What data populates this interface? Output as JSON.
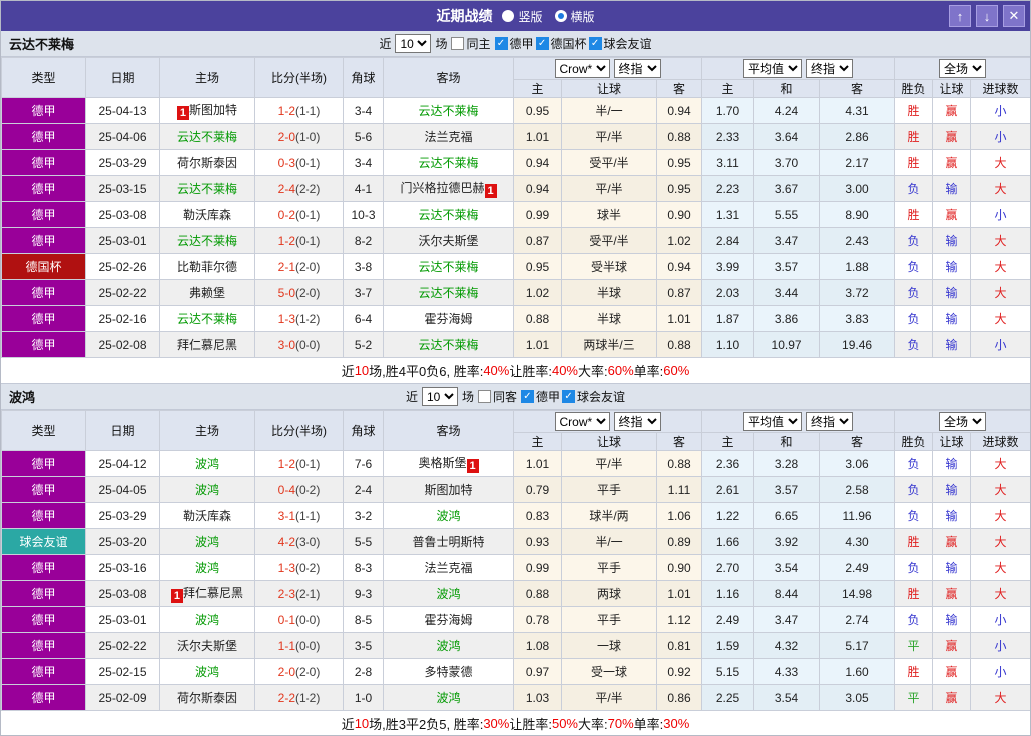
{
  "title_bar": {
    "title": "近期战绩",
    "radios": [
      {
        "label": "竖版",
        "selected": false
      },
      {
        "label": "横版",
        "selected": true
      }
    ],
    "buttons": {
      "up": "↑",
      "down": "↓",
      "close": "✕"
    }
  },
  "icons": {
    "check": "✓",
    "up-arrow": "↑",
    "down-arrow": "↓",
    "close": "✕"
  },
  "table_header": {
    "main": [
      "类型",
      "日期",
      "主场",
      "比分(半场)",
      "角球",
      "客场"
    ],
    "sub": [
      "主",
      "让球",
      "客",
      "主",
      "和",
      "客",
      "胜负",
      "让球",
      "进球数"
    ],
    "selects": {
      "crow": "Crow*",
      "final1": "终指",
      "avg": "平均值",
      "final2": "终指",
      "full": "全场"
    }
  },
  "league_colors": {
    "德甲": "#990099",
    "德国杯": "#b01111",
    "球会友谊": "#2ba8a4"
  },
  "status_colors": {
    "win": "#e02020",
    "lose": "#3535cf",
    "draw": "#2ba32b",
    "big": "#e02020",
    "small": "#3535cf"
  },
  "sections": [
    {
      "team": "云达不莱梅",
      "filter": {
        "prefix": "近",
        "count": "10",
        "suffix": "场",
        "same": {
          "label": "同主",
          "checked": false
        },
        "leagues": [
          {
            "label": "德甲",
            "checked": true
          },
          {
            "label": "德国杯",
            "checked": true
          },
          {
            "label": "球会友谊",
            "checked": true
          }
        ]
      },
      "rows": [
        {
          "league": "德甲",
          "date": "25-04-13",
          "home": {
            "name": "斯图加特",
            "self": false,
            "card": "before"
          },
          "score": {
            "ft": "1-2",
            "ht": "(1-1)"
          },
          "corner": "3-4",
          "away": {
            "name": "云达不莱梅",
            "self": true,
            "card": null
          },
          "odds": [
            "0.95",
            "半/一",
            "0.94"
          ],
          "avg": [
            "1.70",
            "4.24",
            "4.31"
          ],
          "results": [
            [
              "胜",
              "win"
            ],
            [
              "赢",
              "win"
            ],
            [
              "小",
              "small"
            ]
          ]
        },
        {
          "league": "德甲",
          "date": "25-04-06",
          "home": {
            "name": "云达不莱梅",
            "self": true,
            "card": null
          },
          "score": {
            "ft": "2-0",
            "ht": "(1-0)"
          },
          "corner": "5-6",
          "away": {
            "name": "法兰克福",
            "self": false,
            "card": null
          },
          "odds": [
            "1.01",
            "平/半",
            "0.88"
          ],
          "avg": [
            "2.33",
            "3.64",
            "2.86"
          ],
          "results": [
            [
              "胜",
              "win"
            ],
            [
              "赢",
              "win"
            ],
            [
              "小",
              "small"
            ]
          ]
        },
        {
          "league": "德甲",
          "date": "25-03-29",
          "home": {
            "name": "荷尔斯泰因",
            "self": false,
            "card": null
          },
          "score": {
            "ft": "0-3",
            "ht": "(0-1)"
          },
          "corner": "3-4",
          "away": {
            "name": "云达不莱梅",
            "self": true,
            "card": null
          },
          "odds": [
            "0.94",
            "受平/半",
            "0.95"
          ],
          "avg": [
            "3.11",
            "3.70",
            "2.17"
          ],
          "results": [
            [
              "胜",
              "win"
            ],
            [
              "赢",
              "win"
            ],
            [
              "大",
              "big"
            ]
          ]
        },
        {
          "league": "德甲",
          "date": "25-03-15",
          "home": {
            "name": "云达不莱梅",
            "self": true,
            "card": null
          },
          "score": {
            "ft": "2-4",
            "ht": "(2-2)"
          },
          "corner": "4-1",
          "away": {
            "name": "门兴格拉德巴赫",
            "self": false,
            "card": "after"
          },
          "odds": [
            "0.94",
            "平/半",
            "0.95"
          ],
          "avg": [
            "2.23",
            "3.67",
            "3.00"
          ],
          "results": [
            [
              "负",
              "lose"
            ],
            [
              "输",
              "lose"
            ],
            [
              "大",
              "big"
            ]
          ]
        },
        {
          "league": "德甲",
          "date": "25-03-08",
          "home": {
            "name": "勒沃库森",
            "self": false,
            "card": null
          },
          "score": {
            "ft": "0-2",
            "ht": "(0-1)"
          },
          "corner": "10-3",
          "away": {
            "name": "云达不莱梅",
            "self": true,
            "card": null
          },
          "odds": [
            "0.99",
            "球半",
            "0.90"
          ],
          "avg": [
            "1.31",
            "5.55",
            "8.90"
          ],
          "results": [
            [
              "胜",
              "win"
            ],
            [
              "赢",
              "win"
            ],
            [
              "小",
              "small"
            ]
          ]
        },
        {
          "league": "德甲",
          "date": "25-03-01",
          "home": {
            "name": "云达不莱梅",
            "self": true,
            "card": null
          },
          "score": {
            "ft": "1-2",
            "ht": "(0-1)"
          },
          "corner": "8-2",
          "away": {
            "name": "沃尔夫斯堡",
            "self": false,
            "card": null
          },
          "odds": [
            "0.87",
            "受平/半",
            "1.02"
          ],
          "avg": [
            "2.84",
            "3.47",
            "2.43"
          ],
          "results": [
            [
              "负",
              "lose"
            ],
            [
              "输",
              "lose"
            ],
            [
              "大",
              "big"
            ]
          ]
        },
        {
          "league": "德国杯",
          "date": "25-02-26",
          "home": {
            "name": "比勒菲尔德",
            "self": false,
            "card": null
          },
          "score": {
            "ft": "2-1",
            "ht": "(2-0)"
          },
          "corner": "3-8",
          "away": {
            "name": "云达不莱梅",
            "self": true,
            "card": null
          },
          "odds": [
            "0.95",
            "受半球",
            "0.94"
          ],
          "avg": [
            "3.99",
            "3.57",
            "1.88"
          ],
          "results": [
            [
              "负",
              "lose"
            ],
            [
              "输",
              "lose"
            ],
            [
              "大",
              "big"
            ]
          ]
        },
        {
          "league": "德甲",
          "date": "25-02-22",
          "home": {
            "name": "弗赖堡",
            "self": false,
            "card": null
          },
          "score": {
            "ft": "5-0",
            "ht": "(2-0)"
          },
          "corner": "3-7",
          "away": {
            "name": "云达不莱梅",
            "self": true,
            "card": null
          },
          "odds": [
            "1.02",
            "半球",
            "0.87"
          ],
          "avg": [
            "2.03",
            "3.44",
            "3.72"
          ],
          "results": [
            [
              "负",
              "lose"
            ],
            [
              "输",
              "lose"
            ],
            [
              "大",
              "big"
            ]
          ]
        },
        {
          "league": "德甲",
          "date": "25-02-16",
          "home": {
            "name": "云达不莱梅",
            "self": true,
            "card": null
          },
          "score": {
            "ft": "1-3",
            "ht": "(1-2)"
          },
          "corner": "6-4",
          "away": {
            "name": "霍芬海姆",
            "self": false,
            "card": null
          },
          "odds": [
            "0.88",
            "半球",
            "1.01"
          ],
          "avg": [
            "1.87",
            "3.86",
            "3.83"
          ],
          "results": [
            [
              "负",
              "lose"
            ],
            [
              "输",
              "lose"
            ],
            [
              "大",
              "big"
            ]
          ]
        },
        {
          "league": "德甲",
          "date": "25-02-08",
          "home": {
            "name": "拜仁慕尼黑",
            "self": false,
            "card": null
          },
          "score": {
            "ft": "3-0",
            "ht": "(0-0)"
          },
          "corner": "5-2",
          "away": {
            "name": "云达不莱梅",
            "self": true,
            "card": null
          },
          "odds": [
            "1.01",
            "两球半/三",
            "0.88"
          ],
          "avg": [
            "1.10",
            "10.97",
            "19.46"
          ],
          "results": [
            [
              "负",
              "lose"
            ],
            [
              "输",
              "lose"
            ],
            [
              "小",
              "small"
            ]
          ]
        }
      ],
      "summary": [
        [
          "近",
          "b"
        ],
        [
          "10",
          "r"
        ],
        [
          "场,胜4平0负6, 胜率:",
          "b"
        ],
        [
          "40%",
          "r"
        ],
        [
          " 让胜率:",
          "b"
        ],
        [
          "40%",
          "r"
        ],
        [
          " 大率:",
          "b"
        ],
        [
          "60%",
          "r"
        ],
        [
          " 单率:",
          "b"
        ],
        [
          "60%",
          "r"
        ]
      ]
    },
    {
      "team": "波鸿",
      "filter": {
        "prefix": "近",
        "count": "10",
        "suffix": "场",
        "same": {
          "label": "同客",
          "checked": false
        },
        "leagues": [
          {
            "label": "德甲",
            "checked": true
          },
          {
            "label": "球会友谊",
            "checked": true
          }
        ]
      },
      "rows": [
        {
          "league": "德甲",
          "date": "25-04-12",
          "home": {
            "name": "波鸿",
            "self": true,
            "card": null
          },
          "score": {
            "ft": "1-2",
            "ht": "(0-1)"
          },
          "corner": "7-6",
          "away": {
            "name": "奥格斯堡",
            "self": false,
            "card": "after"
          },
          "odds": [
            "1.01",
            "平/半",
            "0.88"
          ],
          "avg": [
            "2.36",
            "3.28",
            "3.06"
          ],
          "results": [
            [
              "负",
              "lose"
            ],
            [
              "输",
              "lose"
            ],
            [
              "大",
              "big"
            ]
          ]
        },
        {
          "league": "德甲",
          "date": "25-04-05",
          "home": {
            "name": "波鸿",
            "self": true,
            "card": null
          },
          "score": {
            "ft": "0-4",
            "ht": "(0-2)"
          },
          "corner": "2-4",
          "away": {
            "name": "斯图加特",
            "self": false,
            "card": null
          },
          "odds": [
            "0.79",
            "平手",
            "1.11"
          ],
          "avg": [
            "2.61",
            "3.57",
            "2.58"
          ],
          "results": [
            [
              "负",
              "lose"
            ],
            [
              "输",
              "lose"
            ],
            [
              "大",
              "big"
            ]
          ]
        },
        {
          "league": "德甲",
          "date": "25-03-29",
          "home": {
            "name": "勒沃库森",
            "self": false,
            "card": null
          },
          "score": {
            "ft": "3-1",
            "ht": "(1-1)"
          },
          "corner": "3-2",
          "away": {
            "name": "波鸿",
            "self": true,
            "card": null
          },
          "odds": [
            "0.83",
            "球半/两",
            "1.06"
          ],
          "avg": [
            "1.22",
            "6.65",
            "11.96"
          ],
          "results": [
            [
              "负",
              "lose"
            ],
            [
              "输",
              "lose"
            ],
            [
              "大",
              "big"
            ]
          ]
        },
        {
          "league": "球会友谊",
          "date": "25-03-20",
          "home": {
            "name": "波鸿",
            "self": true,
            "card": null
          },
          "score": {
            "ft": "4-2",
            "ht": "(3-0)"
          },
          "corner": "5-5",
          "away": {
            "name": "普鲁士明斯特",
            "self": false,
            "card": null
          },
          "odds": [
            "0.93",
            "半/一",
            "0.89"
          ],
          "avg": [
            "1.66",
            "3.92",
            "4.30"
          ],
          "results": [
            [
              "胜",
              "win"
            ],
            [
              "赢",
              "win"
            ],
            [
              "大",
              "big"
            ]
          ]
        },
        {
          "league": "德甲",
          "date": "25-03-16",
          "home": {
            "name": "波鸿",
            "self": true,
            "card": null
          },
          "score": {
            "ft": "1-3",
            "ht": "(0-2)"
          },
          "corner": "8-3",
          "away": {
            "name": "法兰克福",
            "self": false,
            "card": null
          },
          "odds": [
            "0.99",
            "平手",
            "0.90"
          ],
          "avg": [
            "2.70",
            "3.54",
            "2.49"
          ],
          "results": [
            [
              "负",
              "lose"
            ],
            [
              "输",
              "lose"
            ],
            [
              "大",
              "big"
            ]
          ]
        },
        {
          "league": "德甲",
          "date": "25-03-08",
          "home": {
            "name": "拜仁慕尼黑",
            "self": false,
            "card": "before"
          },
          "score": {
            "ft": "2-3",
            "ht": "(2-1)"
          },
          "corner": "9-3",
          "away": {
            "name": "波鸿",
            "self": true,
            "card": null
          },
          "odds": [
            "0.88",
            "两球",
            "1.01"
          ],
          "avg": [
            "1.16",
            "8.44",
            "14.98"
          ],
          "results": [
            [
              "胜",
              "win"
            ],
            [
              "赢",
              "win"
            ],
            [
              "大",
              "big"
            ]
          ]
        },
        {
          "league": "德甲",
          "date": "25-03-01",
          "home": {
            "name": "波鸿",
            "self": true,
            "card": null
          },
          "score": {
            "ft": "0-1",
            "ht": "(0-0)"
          },
          "corner": "8-5",
          "away": {
            "name": "霍芬海姆",
            "self": false,
            "card": null
          },
          "odds": [
            "0.78",
            "平手",
            "1.12"
          ],
          "avg": [
            "2.49",
            "3.47",
            "2.74"
          ],
          "results": [
            [
              "负",
              "lose"
            ],
            [
              "输",
              "lose"
            ],
            [
              "小",
              "small"
            ]
          ]
        },
        {
          "league": "德甲",
          "date": "25-02-22",
          "home": {
            "name": "沃尔夫斯堡",
            "self": false,
            "card": null
          },
          "score": {
            "ft": "1-1",
            "ht": "(0-0)"
          },
          "corner": "3-5",
          "away": {
            "name": "波鸿",
            "self": true,
            "card": null
          },
          "odds": [
            "1.08",
            "一球",
            "0.81"
          ],
          "avg": [
            "1.59",
            "4.32",
            "5.17"
          ],
          "results": [
            [
              "平",
              "draw"
            ],
            [
              "赢",
              "win"
            ],
            [
              "小",
              "small"
            ]
          ]
        },
        {
          "league": "德甲",
          "date": "25-02-15",
          "home": {
            "name": "波鸿",
            "self": true,
            "card": null
          },
          "score": {
            "ft": "2-0",
            "ht": "(2-0)"
          },
          "corner": "2-8",
          "away": {
            "name": "多特蒙德",
            "self": false,
            "card": null
          },
          "odds": [
            "0.97",
            "受一球",
            "0.92"
          ],
          "avg": [
            "5.15",
            "4.33",
            "1.60"
          ],
          "results": [
            [
              "胜",
              "win"
            ],
            [
              "赢",
              "win"
            ],
            [
              "小",
              "small"
            ]
          ]
        },
        {
          "league": "德甲",
          "date": "25-02-09",
          "home": {
            "name": "荷尔斯泰因",
            "self": false,
            "card": null
          },
          "score": {
            "ft": "2-2",
            "ht": "(1-2)"
          },
          "corner": "1-0",
          "away": {
            "name": "波鸿",
            "self": true,
            "card": null
          },
          "odds": [
            "1.03",
            "平/半",
            "0.86"
          ],
          "avg": [
            "2.25",
            "3.54",
            "3.05"
          ],
          "results": [
            [
              "平",
              "draw"
            ],
            [
              "赢",
              "win"
            ],
            [
              "大",
              "big"
            ]
          ]
        }
      ],
      "summary": [
        [
          "近",
          "b"
        ],
        [
          "10",
          "r"
        ],
        [
          "场,胜3平2负5, 胜率:",
          "b"
        ],
        [
          "30%",
          "r"
        ],
        [
          " 让胜率:",
          "b"
        ],
        [
          "50%",
          "r"
        ],
        [
          " 大率:",
          "b"
        ],
        [
          "70%",
          "r"
        ],
        [
          " 单率:",
          "b"
        ],
        [
          "30%",
          "r"
        ]
      ]
    }
  ]
}
